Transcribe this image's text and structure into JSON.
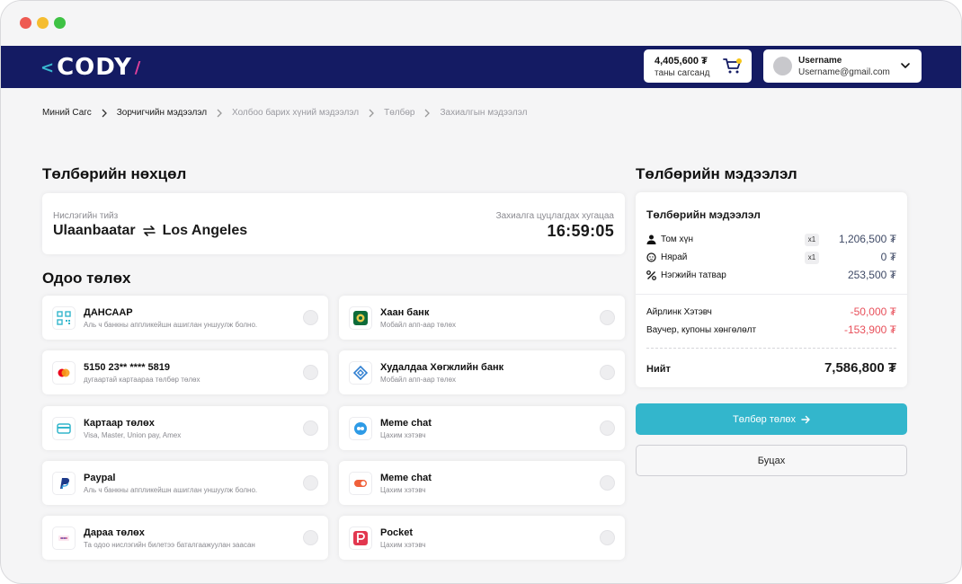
{
  "header": {
    "logo_left": "<",
    "logo_text": "CODY",
    "logo_right": "/",
    "cart_amount": "4,405,600 ₮",
    "cart_label": "таны сагсанд",
    "username": "Username",
    "email": "Username@gmail.com"
  },
  "breadcrumb": [
    "Миний Сагс",
    "Зорчигчийн мэдээлэл",
    "Холбоо барих хүний мэдээлэл",
    "Төлбөр",
    "Захиалгын мэдээлэл"
  ],
  "left": {
    "terms_title": "Төлбөрийн нөхцөл",
    "route": {
      "label": "Нислэгийн тийз",
      "from": "Ulaanbaatar",
      "to": "Los Angeles",
      "timer_label": "Захиалга цуцлагдах хугацаа",
      "timer": "16:59:05"
    },
    "pay_now_title": "Одоо төлөх",
    "methods": [
      {
        "title": "ДАНСААР",
        "subtitle": "Аль ч банкны аппликейшн ашиглан уншуулж болно.",
        "icon": "qr-icon"
      },
      {
        "title": "Хаан банк",
        "subtitle": "Мобайл апп-аар төлөх",
        "icon": "khan-bank-icon"
      },
      {
        "title": "5150 23** **** 5819",
        "subtitle": "дугаартай картаараа төлбөр төлөх",
        "icon": "mastercard-icon"
      },
      {
        "title": "Худалдаа Хөгжлийн банк",
        "subtitle": "Мобайл апп-аар төлөх",
        "icon": "tdb-icon"
      },
      {
        "title": "Картаар төлөх",
        "subtitle": "Visa, Master, Union pay, Amex",
        "icon": "card-icon"
      },
      {
        "title": "Meme chat",
        "subtitle": "Цахим хэтэвч",
        "icon": "meme-chat-icon"
      },
      {
        "title": "Paypal",
        "subtitle": "Аль ч банкны аппликейшн ашиглан уншуулж болно.",
        "icon": "paypal-icon"
      },
      {
        "title": "Meme chat",
        "subtitle": "Цахим хэтэвч",
        "icon": "toggle-wallet-icon"
      },
      {
        "title": "Дараа төлөх",
        "subtitle": "Та одоо нислэгийн билетээ баталгаажуулан заасан",
        "icon": "pay-later-icon"
      },
      {
        "title": "Pocket",
        "subtitle": "Цахим хэтэвч",
        "icon": "pocket-icon"
      }
    ]
  },
  "summary": {
    "section_title": "Төлбөрийн мэдээлэл",
    "card_title": "Төлбөрийн мэдээлэл",
    "rows": [
      {
        "label": "Том хүн",
        "qty": "x1",
        "value": "1,206,500 ₮",
        "icon": "person-icon"
      },
      {
        "label": "Нярай",
        "qty": "x1",
        "value": "0 ₮",
        "icon": "baby-icon"
      },
      {
        "label": "Нэгжийн татвар",
        "qty": "",
        "value": "253,500 ₮",
        "icon": "percent-icon"
      }
    ],
    "discounts": [
      {
        "label": "Айрлинк Хэтэвч",
        "value": "-50,000 ₮"
      },
      {
        "label": "Ваучер, купоны хөнгөлөлт",
        "value": "-153,900 ₮"
      }
    ],
    "total_label": "Нийт",
    "total_value": "7,586,800 ₮",
    "pay_button": "Төлбөр төлөх",
    "back_button": "Буцах"
  },
  "colors": {
    "header_bg": "#141b63",
    "accent": "#33b6cc",
    "negative": "#e8505b"
  }
}
